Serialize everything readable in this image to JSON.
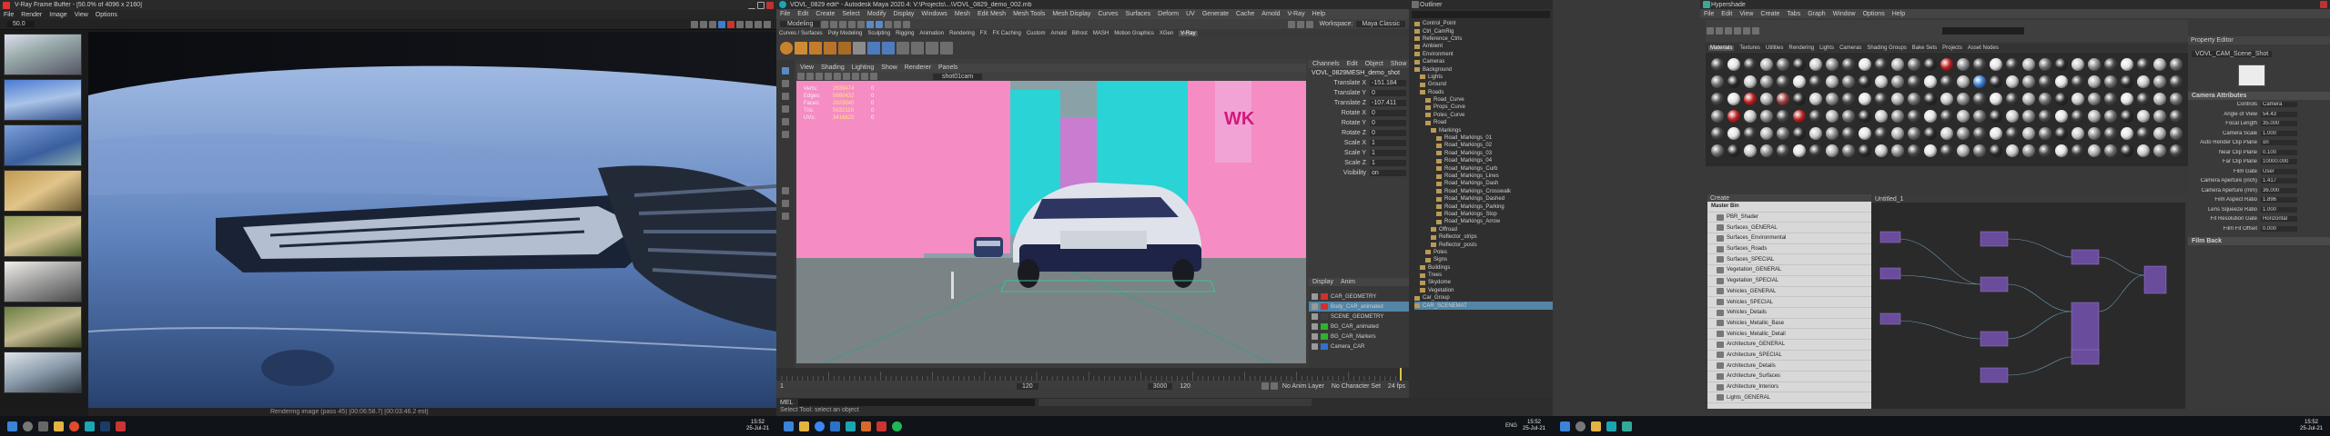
{
  "renderer": {
    "window_title": "V-Ray Frame Buffer - [50.0% of 4096 x 2160]",
    "menu": [
      "File",
      "Render",
      "Image",
      "View",
      "Options"
    ],
    "zoom_value": "50.0",
    "status_text": "Rendering image (pass 45) [00:06:58.7] [00:03:46.2 est]"
  },
  "maya": {
    "window_title": "VOVL_0829 edit* - Autodesk Maya 2020.4: V:\\Projects\\...\\VOVL_0829_demo_002.mb",
    "menu": [
      "File",
      "Edit",
      "Create",
      "Select",
      "Modify",
      "Display",
      "Windows",
      "Mesh",
      "Edit Mesh",
      "Mesh Tools",
      "Mesh Display",
      "Curves",
      "Surfaces",
      "Deform",
      "UV",
      "Generate",
      "Cache",
      "Arnold",
      "V-Ray",
      "Help"
    ],
    "workspace_label": "Workspace:",
    "workspace_value": "Maya Classic",
    "mode_value": "Modeling",
    "shelf_tabs": [
      "Curves / Surfaces",
      "Poly Modeling",
      "Sculpting",
      "Rigging",
      "Animation",
      "Rendering",
      "FX",
      "FX Caching",
      "Custom",
      "Arnold",
      "Bifrost",
      "MASH",
      "Motion Graphics",
      "XGen",
      "V-Ray"
    ],
    "panel_menu": [
      "View",
      "Shading",
      "Lighting",
      "Show",
      "Renderer",
      "Panels"
    ],
    "camera_label": "shot01cam",
    "hud": [
      {
        "label": "Verts:",
        "a": "2839474",
        "b": "0"
      },
      {
        "label": "Edges:",
        "a": "5660432",
        "b": "0"
      },
      {
        "label": "Faces:",
        "a": "2823540",
        "b": "0"
      },
      {
        "label": "Tris:",
        "a": "5632118",
        "b": "0"
      },
      {
        "label": "UVs:",
        "a": "3416820",
        "b": "0"
      }
    ],
    "billboard_text": "WK",
    "channel_tabs": [
      "Channels",
      "Edit",
      "Object",
      "Show"
    ],
    "channel_object": "VOVL_0829MESH_demo_shot",
    "channels": [
      {
        "name": "Translate X",
        "value": "-151.184"
      },
      {
        "name": "Translate Y",
        "value": "0"
      },
      {
        "name": "Translate Z",
        "value": "-107.411"
      },
      {
        "name": "Rotate X",
        "value": "0"
      },
      {
        "name": "Rotate Y",
        "value": "0"
      },
      {
        "name": "Rotate Z",
        "value": "0"
      },
      {
        "name": "Scale X",
        "value": "1"
      },
      {
        "name": "Scale Y",
        "value": "1"
      },
      {
        "name": "Scale Z",
        "value": "1"
      },
      {
        "name": "Visibility",
        "value": "on"
      }
    ],
    "layer_tabs": [
      "Display",
      "Anim"
    ],
    "layers": [
      "CAR_GEOMETRY",
      "Body_CAR_animated",
      "SCENE_GEOMETRY",
      "BG_CAR_animated",
      "BG_CAR_Markers",
      "Camera_CAR"
    ],
    "outliner_items": [
      "Control_Point",
      "Ctrl_CamRig",
      "Reference_Ctrls",
      "Ambient",
      "Environment",
      "Cameras",
      "Background",
      "Lights",
      "Ground",
      "Roads",
      "Road_Curve",
      "Props_Curve",
      "Poles_Curve",
      "Road",
      "Markings",
      "Road_Markings_01",
      "Road_Markings_02",
      "Road_Markings_03",
      "Road_Markings_04",
      "Road_Markings_Curb",
      "Road_Markings_Lines",
      "Road_Markings_Dash",
      "Road_Markings_Crosswalk",
      "Road_Markings_Dashed",
      "Road_Markings_Parking",
      "Road_Markings_Stop",
      "Road_Markings_Arrow",
      "Offroad",
      "Reflector_strips",
      "Reflector_posts",
      "Poles",
      "Signs",
      "Buildings",
      "Trees",
      "Skydome",
      "Vegetation",
      "Car_Group",
      "CAR_SCENEMAT"
    ],
    "timeline_start": "1",
    "timeline_end": "120",
    "current_frame": "120",
    "range_end": "3000",
    "anim_layer": "No Anim Layer",
    "char_set": "No Character Set",
    "fps": "24 fps",
    "cmd_lang": "MEL",
    "help_line": "Select Tool: select an object"
  },
  "hypershade": {
    "outliner_title": "Outliner",
    "window_title": "Hypershade",
    "menu": [
      "File",
      "Edit",
      "View",
      "Create",
      "Tabs",
      "Graph",
      "Window",
      "Options",
      "Help"
    ],
    "browser_tabs": [
      "Materials",
      "Textures",
      "Utilities",
      "Rendering",
      "Lights",
      "Cameras",
      "Shading Groups",
      "Bake Sets",
      "Projects",
      "Asset Nodes"
    ],
    "create_title": "Create",
    "bin_title": "Master Bin",
    "materials": [
      "PBR_Shader",
      "Surfaces_GENERAL",
      "Surfaces_Environmental",
      "Surfaces_Roads",
      "Surfaces_SPECIAL",
      "Vegetation_GENERAL",
      "Vegetation_SPECIAL",
      "Vehicles_GENERAL",
      "Vehicles_SPECIAL",
      "Vehicles_Details",
      "Vehicles_Metallic_Base",
      "Vehicles_Metallic_Detail",
      "Architecture_GENERAL",
      "Architecture_SPECIAL",
      "Architecture_Details",
      "Architecture_Surfaces",
      "Architecture_Interiors",
      "Lights_GENERAL"
    ],
    "node_editor_title": "Untitled_1",
    "property_title": "Property Editor",
    "property_node": "VOVL_CAM_Scene_Shot",
    "property_sections": [
      "Camera Attributes",
      "Film Back"
    ],
    "property_fields": [
      {
        "label": "Controls",
        "value": "Camera"
      },
      {
        "label": "Angle of View",
        "value": "54.43"
      },
      {
        "label": "Focal Length",
        "value": "35.000"
      },
      {
        "label": "Camera Scale",
        "value": "1.000"
      },
      {
        "label": "Auto Render Clip Plane",
        "value": "on"
      },
      {
        "label": "Near Clip Plane",
        "value": "0.100"
      },
      {
        "label": "Far Clip Plane",
        "value": "10000.000"
      },
      {
        "label": "Film Gate",
        "value": "User"
      },
      {
        "label": "Camera Aperture (inch)",
        "value": "1.417"
      },
      {
        "label": "Camera Aperture (mm)",
        "value": "36.000"
      },
      {
        "label": "Film Aspect Ratio",
        "value": "1.896"
      },
      {
        "label": "Lens Squeeze Ratio",
        "value": "1.000"
      },
      {
        "label": "Fit Resolution Gate",
        "value": "Horizontal"
      },
      {
        "label": "Film Fit Offset",
        "value": "0.000"
      }
    ]
  },
  "taskbar": {
    "monitors": [
      {
        "time": "15:52",
        "date": "25-Jul-21"
      },
      {
        "time": "15:52",
        "date": "25-Jul-21",
        "lang": "ENG"
      },
      {
        "time": "15:52",
        "date": "25-Jul-21"
      }
    ]
  },
  "colors": {
    "taskbar": "#101318",
    "maya_bg": "#444444",
    "pink_wall": "#f58cc4",
    "cyan_wall": "#2ad3d6",
    "car_blue": "#6a8fc2"
  }
}
